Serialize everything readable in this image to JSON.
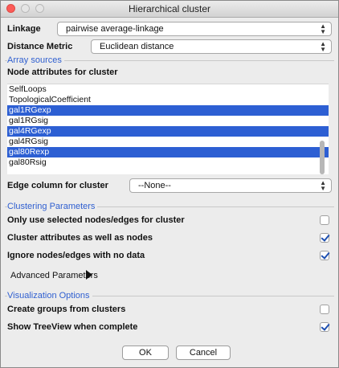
{
  "window": {
    "title": "Hierarchical cluster"
  },
  "linkage": {
    "label": "Linkage",
    "value": "pairwise average-linkage"
  },
  "distance_metric": {
    "label": "Distance Metric",
    "value": "Euclidean distance"
  },
  "array_sources": {
    "title": "Array sources",
    "node_attributes_label": "Node attributes for cluster",
    "items": [
      {
        "label": "SelfLoops",
        "selected": false
      },
      {
        "label": "TopologicalCoefficient",
        "selected": false
      },
      {
        "label": "gal1RGexp",
        "selected": true
      },
      {
        "label": "gal1RGsig",
        "selected": false
      },
      {
        "label": "gal4RGexp",
        "selected": true
      },
      {
        "label": "gal4RGsig",
        "selected": false
      },
      {
        "label": "gal80Rexp",
        "selected": true
      },
      {
        "label": "gal80Rsig",
        "selected": false
      }
    ],
    "edge_column_label": "Edge column for cluster",
    "edge_column_value": "--None--"
  },
  "clustering": {
    "title": "Clustering Parameters",
    "options": [
      {
        "label": "Only use selected nodes/edges for cluster",
        "checked": false
      },
      {
        "label": "Cluster attributes as well as nodes",
        "checked": true
      },
      {
        "label": "Ignore nodes/edges with no data",
        "checked": true
      }
    ]
  },
  "advanced": {
    "label": "Advanced Parameters"
  },
  "visualization": {
    "title": "Visualization Options",
    "options": [
      {
        "label": "Create groups from clusters",
        "checked": false
      },
      {
        "label": "Show TreeView when complete",
        "checked": true
      }
    ]
  },
  "buttons": {
    "ok": "OK",
    "cancel": "Cancel"
  }
}
